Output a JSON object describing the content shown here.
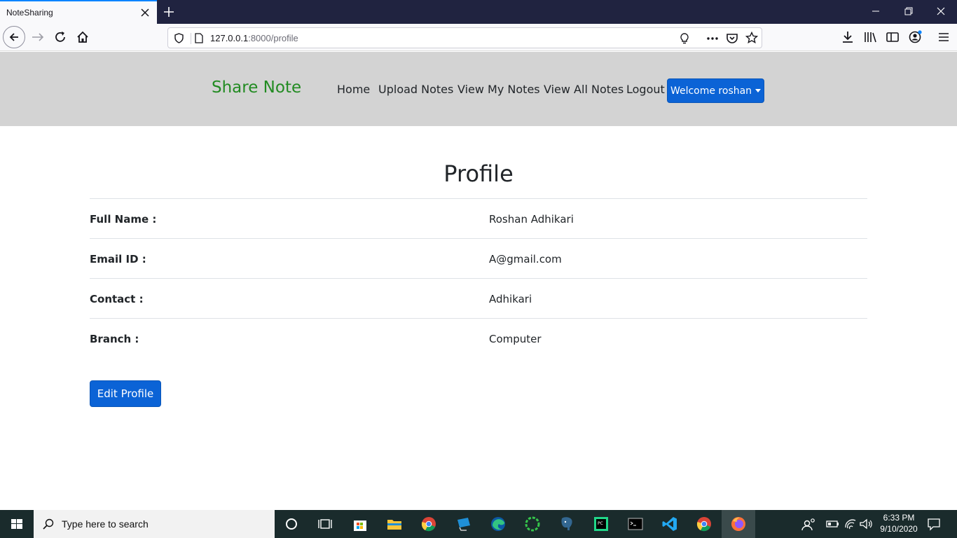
{
  "browser": {
    "tab_title": "NoteSharing",
    "url_host": "127.0.0.1",
    "url_rest": ":8000/profile"
  },
  "site": {
    "brand": "Share Note",
    "nav": [
      "Home",
      "Upload Notes",
      "View My Notes",
      "View All Notes",
      "Logout"
    ],
    "welcome": "Welcome roshan"
  },
  "profile": {
    "title": "Profile",
    "rows": [
      {
        "label": "Full Name :",
        "value": "Roshan Adhikari"
      },
      {
        "label": "Email ID :",
        "value": "A@gmail.com"
      },
      {
        "label": "Contact :",
        "value": "Adhikari"
      },
      {
        "label": "Branch :",
        "value": "Computer"
      }
    ],
    "edit_button": "Edit Profile"
  },
  "taskbar": {
    "search_placeholder": "Type here to search",
    "time": "6:33 PM",
    "date": "9/10/2020"
  },
  "colors": {
    "brand_green": "#228b22",
    "primary_blue": "#0b63d6",
    "header_gray": "#d3d3d3",
    "tabbar_navy": "#202340"
  }
}
